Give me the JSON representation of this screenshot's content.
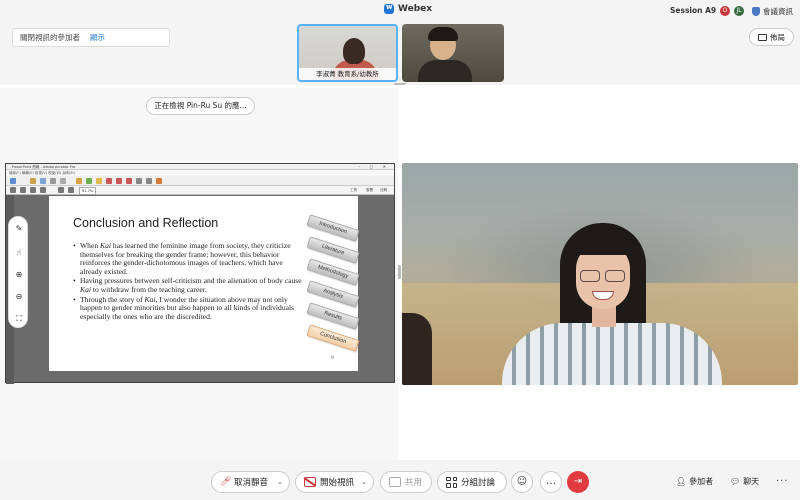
{
  "titlebar": {
    "app_name": "Webex",
    "session": "Session A9",
    "rec_red": "O",
    "rec_green": "JL",
    "meeting_info": "會議資訊"
  },
  "topbar": {
    "hide_video_label": "關閉視訊的參加者",
    "show_link": "顯示",
    "layout_label": "佈局",
    "thumbnails": [
      {
        "label": "李淑菁 教育系/幼教所"
      },
      {
        "label": ""
      }
    ]
  },
  "stage": {
    "viewing_label": "正在檢視 Pin-Ru Su 的應..."
  },
  "shared_window": {
    "title": "PowerPoint 簡報 - Adobe Acrobat Pro",
    "menu": "檔案(F)  編輯(E)  檢視(V)  視窗(W)  說明(H)",
    "zoom": "92.7%",
    "right_tools": [
      "工具",
      "簽署",
      "註解"
    ]
  },
  "slide": {
    "title": "Conclusion and Reflection",
    "bullets": [
      {
        "pre": "When ",
        "em": "Kai",
        "post": " has learned the feminine image from society, they criticize themselves for breaking the gender frame; however, this behavior reinforces the gender-dichotomous images of teachers, which have already existed."
      },
      {
        "pre": "Having pressures between self-criticism and the alienation of body cause ",
        "em": "Kai",
        "post": " to withdraw from the teaching career."
      },
      {
        "pre": "Through the story of ",
        "em": "Kai",
        "post": ", I wonder the situation above may not only happen to gender minorities but also happen to all kinds of individuals especially the ones who are the discredited."
      }
    ],
    "page_number": "9",
    "nav_tabs": [
      "Introduction",
      "Literature",
      "Methodology",
      "Analysis",
      "Results",
      "Conclusion"
    ],
    "active_tab": "Conclusion"
  },
  "controls": {
    "mute_label": "取消靜音",
    "video_label": "開始視訊",
    "share_label": "共用",
    "breakout_label": "分組討論",
    "participants_label": "參加者",
    "chat_label": "聊天"
  },
  "colors": {
    "accent": "#2f7fd6",
    "end_red": "#e03b3e",
    "mute_red": "#d0363a",
    "active_tab": "#f2cfa8"
  }
}
